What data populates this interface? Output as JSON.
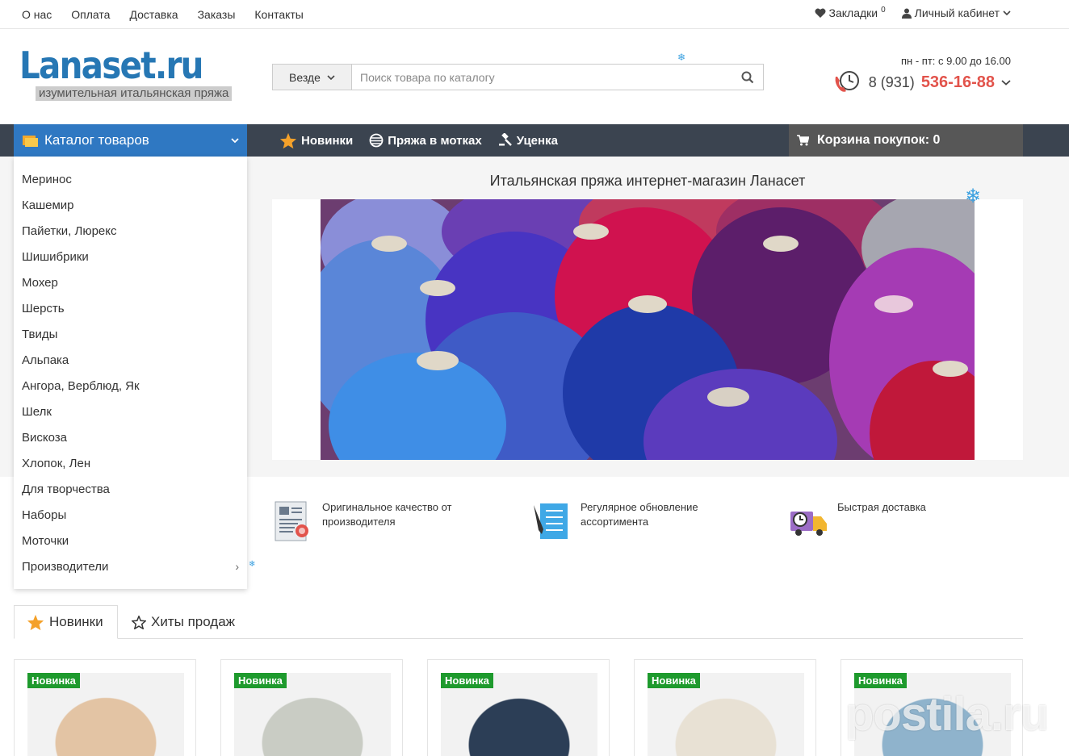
{
  "topnav": [
    "О нас",
    "Оплата",
    "Доставка",
    "Заказы",
    "Контакты"
  ],
  "topright": {
    "bookmarks_label": "Закладки",
    "bookmarks_count": "0",
    "account_label": "Личный кабинет"
  },
  "logo": {
    "main": "Lanaset.ru",
    "tagline": "изумительная итальянская пряжа"
  },
  "search": {
    "scope": "Везде",
    "placeholder": "Поиск товара по каталогу"
  },
  "contact": {
    "hours": "пн - пт: с 9.00 до 16.00",
    "phone_prefix": "8 (931)",
    "phone_main": "536-16-88"
  },
  "nav": {
    "catalog_label": "Каталог товаров",
    "links": [
      "Новинки",
      "Пряжа в мотках",
      "Уценка"
    ],
    "cart_label": "Корзина покупок: 0"
  },
  "catalog_menu": [
    "Меринос",
    "Кашемир",
    "Пайетки, Люрекс",
    "Шишибрики",
    "Мохер",
    "Шерсть",
    "Твиды",
    "Альпака",
    "Ангора, Верблюд, Як",
    "Шелк",
    "Вискоза",
    "Хлопок, Лен",
    "Для творчества",
    "Наборы",
    "Моточки",
    "Производители"
  ],
  "banner": {
    "title": "Итальянская пряжа интернет-магазин Ланасет"
  },
  "features": [
    {
      "line1": "Оригинальное качество от",
      "line2": "производителя",
      "icon": "certificate-icon"
    },
    {
      "line1": "Регулярное обновление",
      "line2": "ассортимента",
      "icon": "checklist-icon"
    },
    {
      "line1": "Быстрая доставка",
      "line2": "",
      "icon": "delivery-truck-icon"
    }
  ],
  "tabs": [
    {
      "label": "Новинки",
      "icon": "star-filled-icon"
    },
    {
      "label": "Хиты продаж",
      "icon": "star-outline-icon"
    }
  ],
  "products": [
    {
      "badge": "Новинка",
      "color": "#e3c4a4"
    },
    {
      "badge": "Новинка",
      "color": "#c9ccc4"
    },
    {
      "badge": "Новинка",
      "color": "#2c3e56"
    },
    {
      "badge": "Новинка",
      "color": "#e8e1d4"
    },
    {
      "badge": "Новинка",
      "color": "#8fb3cc"
    }
  ],
  "watermark": "postila.ru",
  "colors": {
    "nav_bg": "#3b4450",
    "catalog_blue": "#2f78c2",
    "phone_red": "#e2534b",
    "badge_green": "#1e9a2d"
  }
}
